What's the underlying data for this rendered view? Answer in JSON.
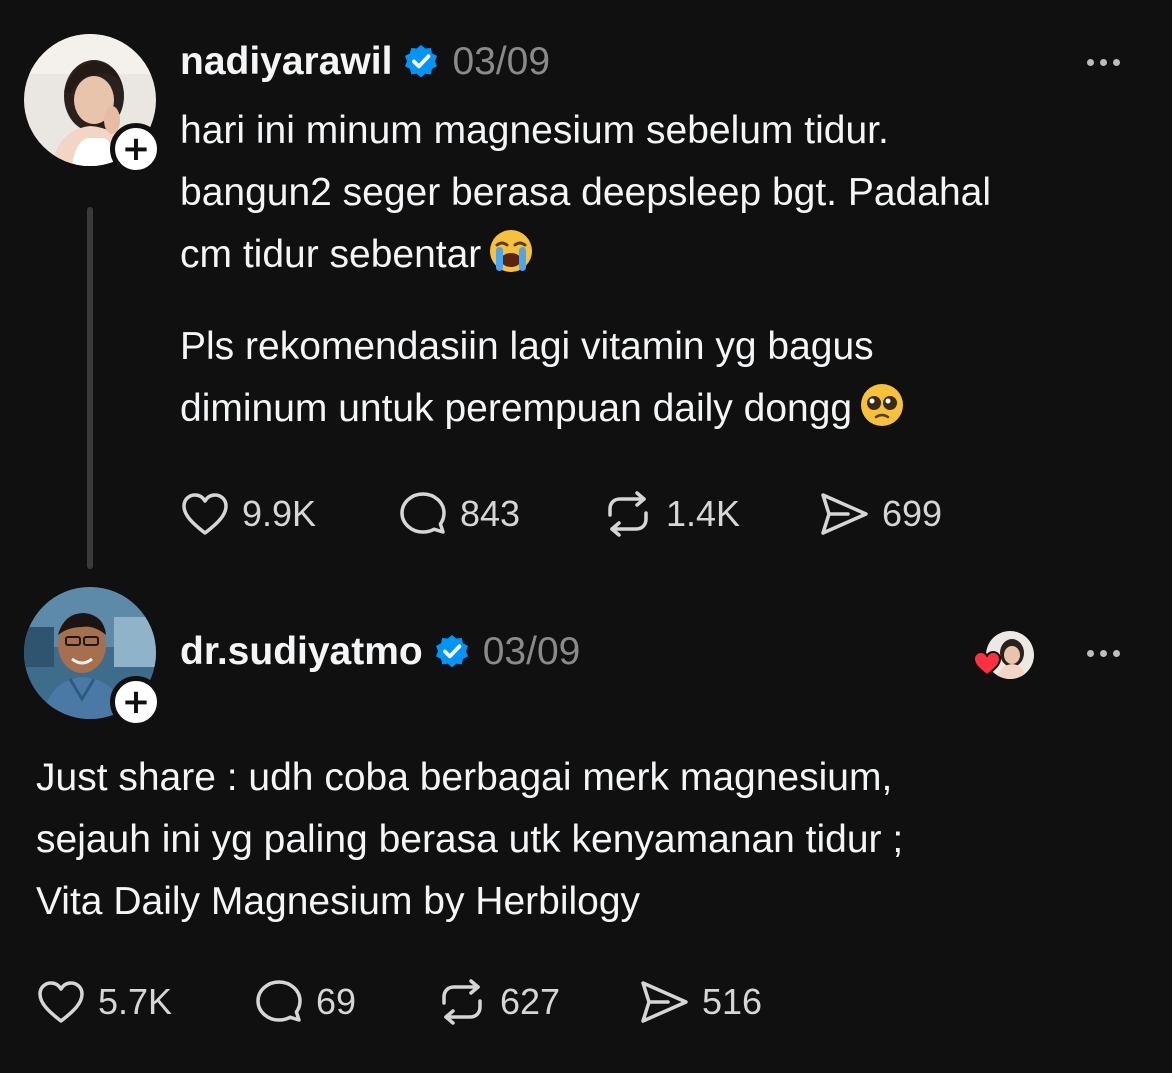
{
  "colors": {
    "background": "#101010",
    "text": "#f3f5f7",
    "muted": "#8a8a8a",
    "verified": "#0095f6",
    "like_red": "#ff3040"
  },
  "posts": [
    {
      "username": "nadiyarawil",
      "date": "03/09",
      "text_p1": "hari ini minum magnesium sebelum tidur.\nbangun2 seger berasa deepsleep bgt. Padahal\ncm tidur sebentar",
      "text_p2": "Pls rekomendasiin lagi vitamin yg bagus\ndiminum untuk perempuan daily dongg",
      "emoji_p1": "loudly-crying-face",
      "emoji_p2": "pleading-face",
      "likes": "9.9K",
      "replies": "843",
      "reposts": "1.4K",
      "shares": "699"
    },
    {
      "username": "dr.sudiyatmo",
      "date": "03/09",
      "text_p1": "Just share : udh coba berbagai merk magnesium,\nsejauh ini yg paling berasa utk kenyamanan tidur ;\nVita Daily Magnesium by Herbilogy",
      "likes": "5.7K",
      "replies": "69",
      "reposts": "627",
      "shares": "516"
    }
  ],
  "icons": {
    "verified": "verified-badge-icon",
    "like": "heart-icon",
    "reply": "speech-bubble-icon",
    "repost": "repost-icon",
    "share": "send-icon",
    "more": "more-dots-icon",
    "follow": "plus-icon"
  }
}
